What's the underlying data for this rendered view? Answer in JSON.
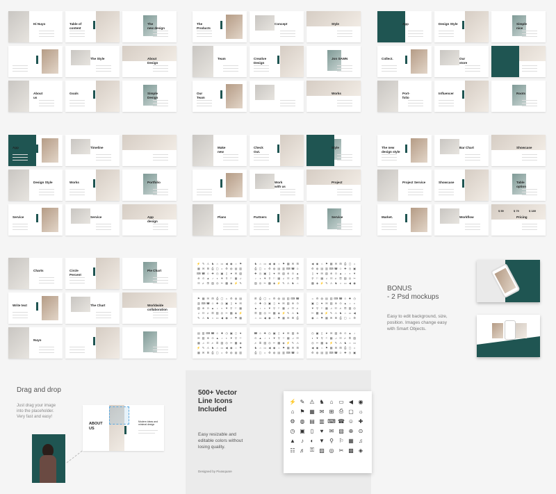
{
  "colors": {
    "accent": "#1f5552",
    "background": "#f5f5f5",
    "slide": "#ffffff"
  },
  "slide_groups": [
    {
      "slides": [
        {
          "title": "Hi Nuyo"
        },
        {
          "title": "Table of\ncontent"
        },
        {
          "title": "The\nnew design"
        },
        {
          "title": ""
        },
        {
          "title": "The Style"
        },
        {
          "title": "About\nDesign"
        },
        {
          "title": "About\nus"
        },
        {
          "title": "Goals"
        },
        {
          "title": "Simple\nDesign"
        }
      ]
    },
    {
      "slides": [
        {
          "title": "The\nProducts"
        },
        {
          "title": "Concept"
        },
        {
          "title": "Style"
        },
        {
          "title": "Team"
        },
        {
          "title": "Creative\nDesign"
        },
        {
          "title": "Jon SAWN"
        },
        {
          "title": "Our\nTeam"
        },
        {
          "title": ""
        },
        {
          "title": "Works"
        }
      ]
    },
    {
      "slides": [
        {
          "title": "App"
        },
        {
          "title": "Design Style"
        },
        {
          "title": "Simple\nnice"
        },
        {
          "title": "Collect."
        },
        {
          "title": "Our\nstore"
        },
        {
          "title": ""
        },
        {
          "title": "Port-\nfolio"
        },
        {
          "title": "Influencer"
        },
        {
          "title": "Roots"
        }
      ]
    },
    {
      "slides": [
        {
          "title": "App"
        },
        {
          "title": "Timeline"
        },
        {
          "title": ""
        },
        {
          "title": "Design Style"
        },
        {
          "title": "Works"
        },
        {
          "title": "Portfolio"
        },
        {
          "title": "Service"
        },
        {
          "title": "Service"
        },
        {
          "title": "App\ndesign"
        }
      ]
    },
    {
      "slides": [
        {
          "title": "Make\nnew"
        },
        {
          "title": "Check\nOut."
        },
        {
          "title": "Style"
        },
        {
          "title": ""
        },
        {
          "title": "Work\nwith us"
        },
        {
          "title": "Project"
        },
        {
          "title": "Plans"
        },
        {
          "title": "Partners"
        },
        {
          "title": "Service"
        }
      ]
    },
    {
      "slides": [
        {
          "title": "The new\ndesign style"
        },
        {
          "title": "Bar Chart"
        },
        {
          "title": "Showcase"
        },
        {
          "title": "Project Service"
        },
        {
          "title": "Showcase"
        },
        {
          "title": "Table\noption"
        },
        {
          "title": "Market."
        },
        {
          "title": "Workflow"
        },
        {
          "title": "Pricing"
        }
      ]
    },
    {
      "slides": [
        {
          "title": "Charts"
        },
        {
          "title": "Circle\nPercent"
        },
        {
          "title": "Pie Chart"
        },
        {
          "title": "Write text"
        },
        {
          "title": "The Chart"
        },
        {
          "title": "Worldwide\ncollaboration"
        },
        {
          "title": "Nuyo"
        },
        {
          "title": ""
        },
        {
          "title": ""
        }
      ]
    },
    {
      "slides": [
        {
          "title": ""
        },
        {
          "title": ""
        },
        {
          "title": ""
        },
        {
          "title": ""
        },
        {
          "title": ""
        },
        {
          "title": ""
        },
        {
          "title": ""
        },
        {
          "title": ""
        },
        {
          "title": ""
        }
      ]
    }
  ],
  "pricing": {
    "p1": "$ 59",
    "p2": "$ 79",
    "p3": "$ 189"
  },
  "bonus": {
    "heading": "BONUS\n- 2 Psd mockups",
    "text": "Easy to edit background, size,\nposition. Images change easy\nwith Smart Objects."
  },
  "drag": {
    "heading": "Drag and drop",
    "text": "Just drag your image\ninto the placeholder.\nVery fast and easy!",
    "slide_title": "ABOUT\nUS",
    "slide_sub": "Modern ideas and\nminimal design"
  },
  "vector": {
    "heading": "500+ Vector\nLine Icons\nIncluded",
    "text": "Easy resizable and\neditable colors without\nlosing quality.",
    "credit": "Designed by Pixasquare"
  },
  "icons": [
    "⚡",
    "✎",
    "⚠",
    "♞",
    "⌂",
    "▭",
    "◀",
    "◉",
    "⌂",
    "⚑",
    "▦",
    "✉",
    "⊞",
    "⎙",
    "▢",
    "☼",
    "⚙",
    "◍",
    "▤",
    "▥",
    "⌨",
    "☎",
    "☺",
    "✚",
    "◷",
    "▣",
    "▯",
    "♥",
    "✉",
    "▧",
    "⊕",
    "⊙",
    "▲",
    "♪",
    "◐",
    "▼",
    "⚲",
    "⚐",
    "▦",
    "♫",
    "☷",
    "♬",
    "⚿",
    "▨",
    "◎",
    "✂",
    "▩",
    "◈"
  ]
}
